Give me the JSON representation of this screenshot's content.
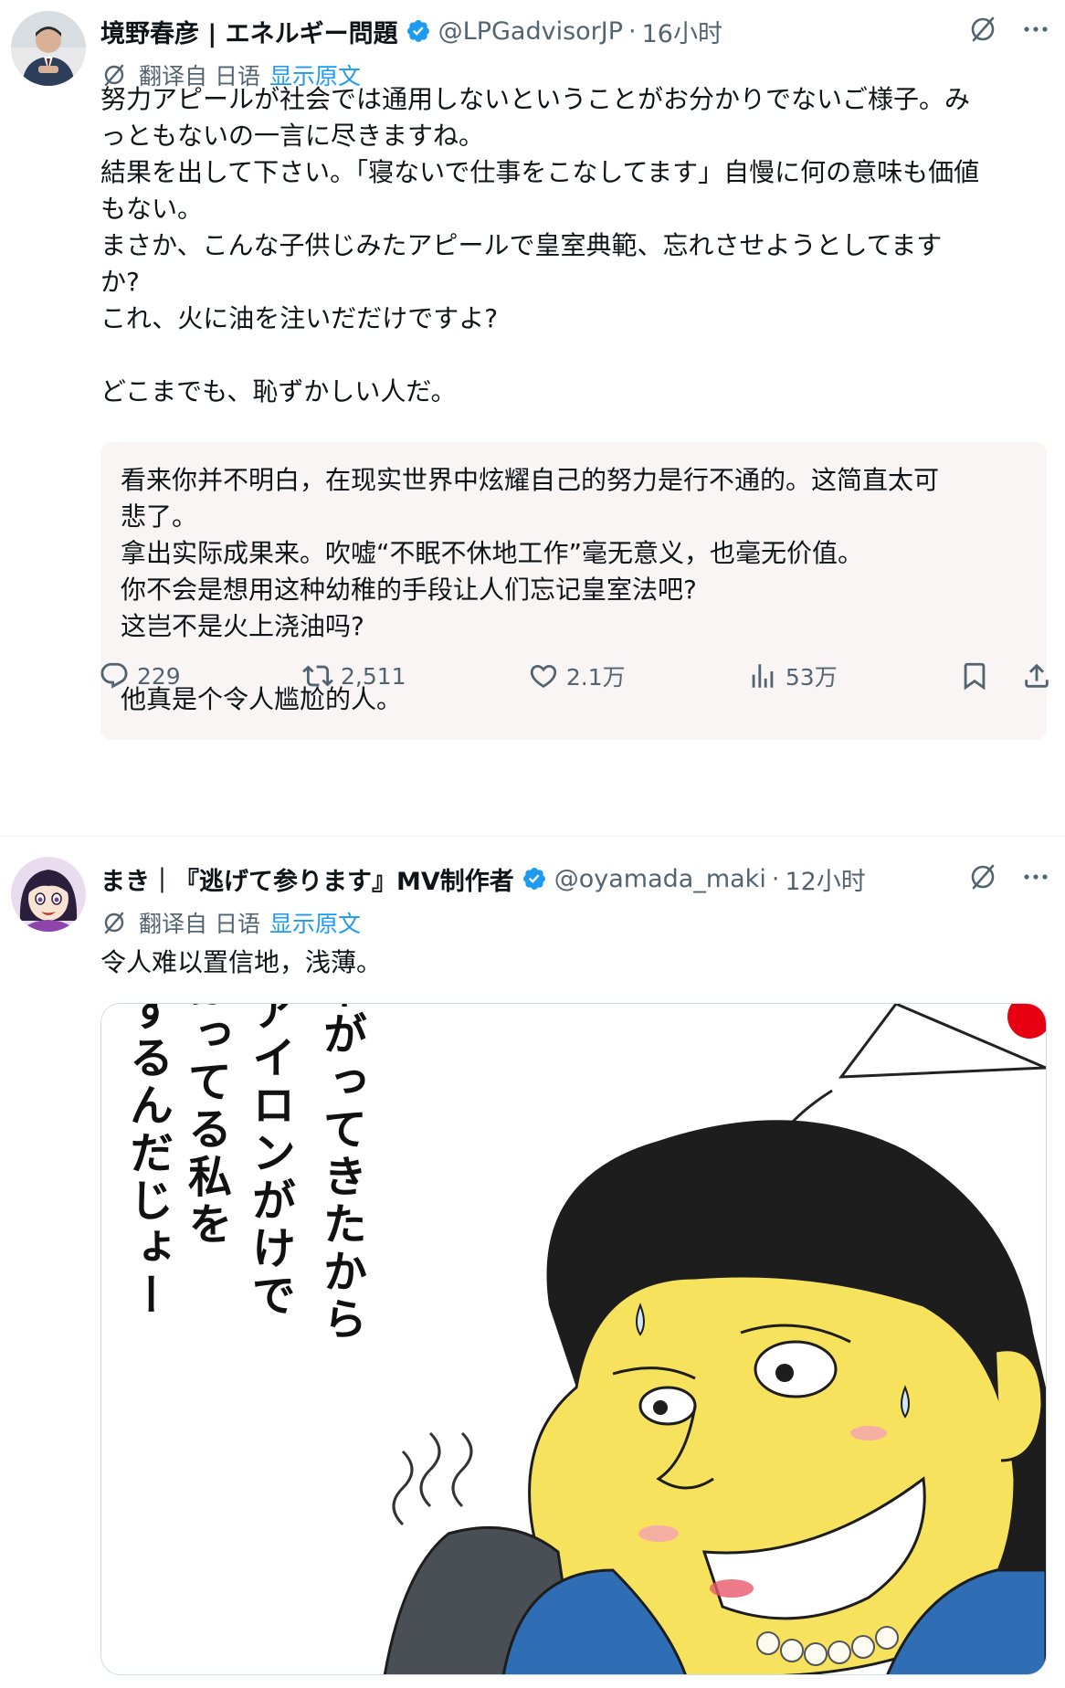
{
  "tweets": [
    {
      "display_name": "境野春彦 | エネルギー問題",
      "handle": "@LPGadvisorJP",
      "separator": "·",
      "time": "16小时",
      "translate": {
        "label": "翻译自 日语",
        "show_original": "显示原文"
      },
      "text": "努力アピールが社会では通用しないということがお分かりでないご様子。み\nっともないの一言に尽きますね。\n結果を出して下さい。「寝ないで仕事をこなしてます」自慢に何の意味も価値\nもない。\nまさか、こんな子供じみたアピールで皇室典範、忘れさせようとしてます\nか?\nこれ、火に油を注いだだけですよ?\n\nどこまでも、恥ずかしい人だ。",
      "translation": "看来你并不明白，在现实世界中炫耀自己的努力是行不通的。这简直太可\n悲了。\n拿出实际成果来。吹嘘“不眠不休地工作”毫无意义，也毫无价值。\n你不会是想用这种幼稚的手段让人们忘记皇室法吧?\n这岂不是火上浇油吗?\n\n他真是个令人尴尬的人。",
      "stats": {
        "replies": "229",
        "retweets": "2,511",
        "likes": "2.1万",
        "views": "53万"
      }
    },
    {
      "display_name": "まき｜『逃げて参ります』MV制作者",
      "handle": "@oyamada_maki",
      "separator": "·",
      "time": "12小时",
      "translate": {
        "label": "翻译自 日语",
        "show_original": "显示原文"
      },
      "text": "令人难以置信地，浅薄。",
      "image_columns": [
        "支持率が下がってきたから",
        "洗い物とアイロンがけで",
        "がんばってる私を",
        "アピールするんだじょー"
      ]
    }
  ],
  "colors": {
    "text": "#0f1419",
    "secondary": "#536471",
    "link": "#1d9bf0",
    "verified": "#1d9bf0",
    "translation_bg": "#f9f5f5"
  },
  "icons": [
    "verified-badge-icon",
    "grok-icon",
    "more-icon",
    "translate-icon",
    "reply-icon",
    "retweet-icon",
    "like-icon",
    "views-icon",
    "bookmark-icon",
    "share-icon"
  ]
}
